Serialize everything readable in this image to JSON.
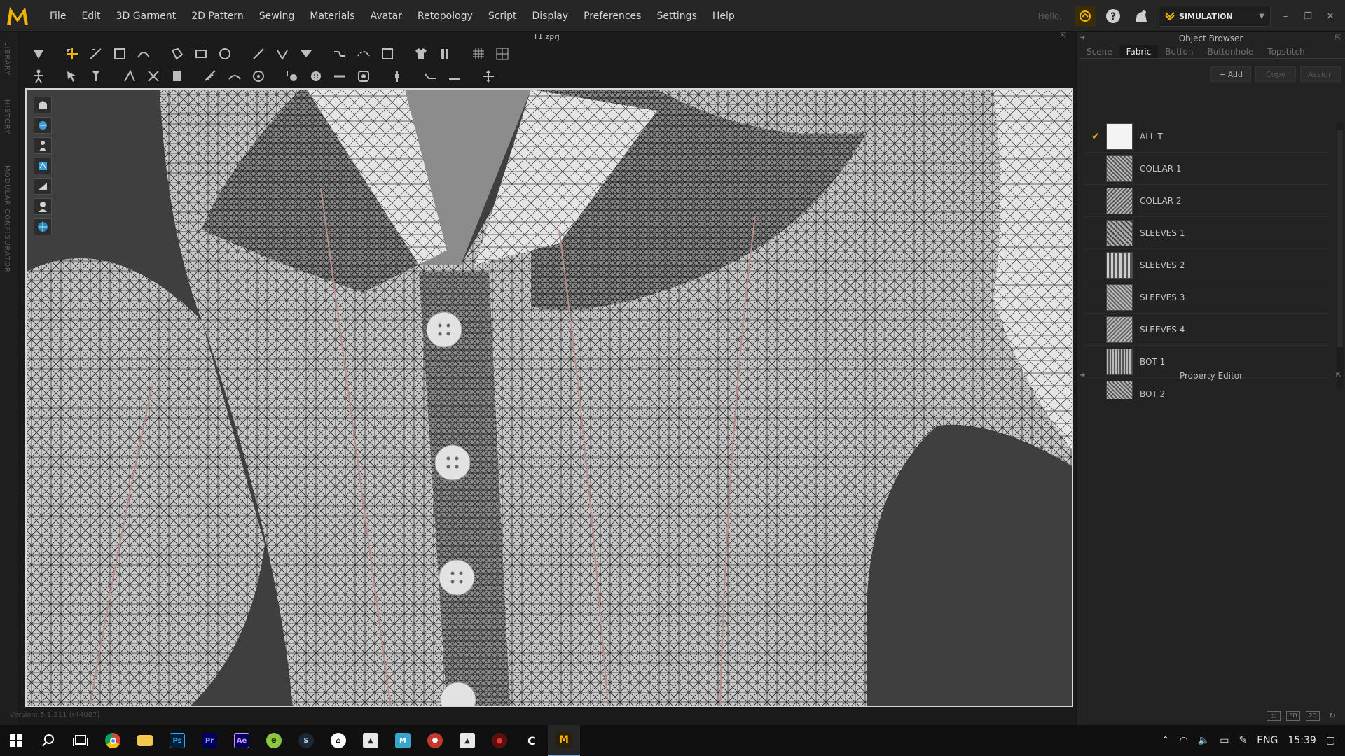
{
  "app": {
    "file_title": "T1.zprj",
    "menu": [
      "File",
      "Edit",
      "3D Garment",
      "2D Pattern",
      "Sewing",
      "Materials",
      "Avatar",
      "Retopology",
      "Script",
      "Display",
      "Preferences",
      "Settings",
      "Help"
    ],
    "hello_text": "Hello,",
    "mode_label": "SIMULATION",
    "version_text": "Version: 5.1.311 (r44087)"
  },
  "left_strip": {
    "tabs": [
      "LIBRARY",
      "HISTORY",
      "MODULAR CONFIGURATOR"
    ]
  },
  "object_browser": {
    "title": "Object Browser",
    "tabs": [
      "Scene",
      "Fabric",
      "Button",
      "Buttonhole",
      "Topstitch"
    ],
    "active_tab": "Fabric",
    "actions": {
      "add": "+ Add",
      "copy": "Copy",
      "assign": "Assign"
    },
    "fabrics": [
      {
        "name": "ALL T",
        "checked": true
      },
      {
        "name": "COLLAR 1",
        "checked": false
      },
      {
        "name": "COLLAR 2",
        "checked": false
      },
      {
        "name": "SLEEVES 1",
        "checked": false
      },
      {
        "name": "SLEEVES 2",
        "checked": false
      },
      {
        "name": "SLEEVES 3",
        "checked": false
      },
      {
        "name": "SLEEVES 4",
        "checked": false
      },
      {
        "name": "BOT 1",
        "checked": false
      },
      {
        "name": "BOT 2",
        "checked": false
      }
    ]
  },
  "property_editor": {
    "title": "Property Editor"
  },
  "taskbar": {
    "language": "ENG",
    "time": "15:39"
  },
  "colors": {
    "accent": "#f2b400",
    "background": "#1b1b1b",
    "viewport_bg": "#3f3f3f"
  }
}
